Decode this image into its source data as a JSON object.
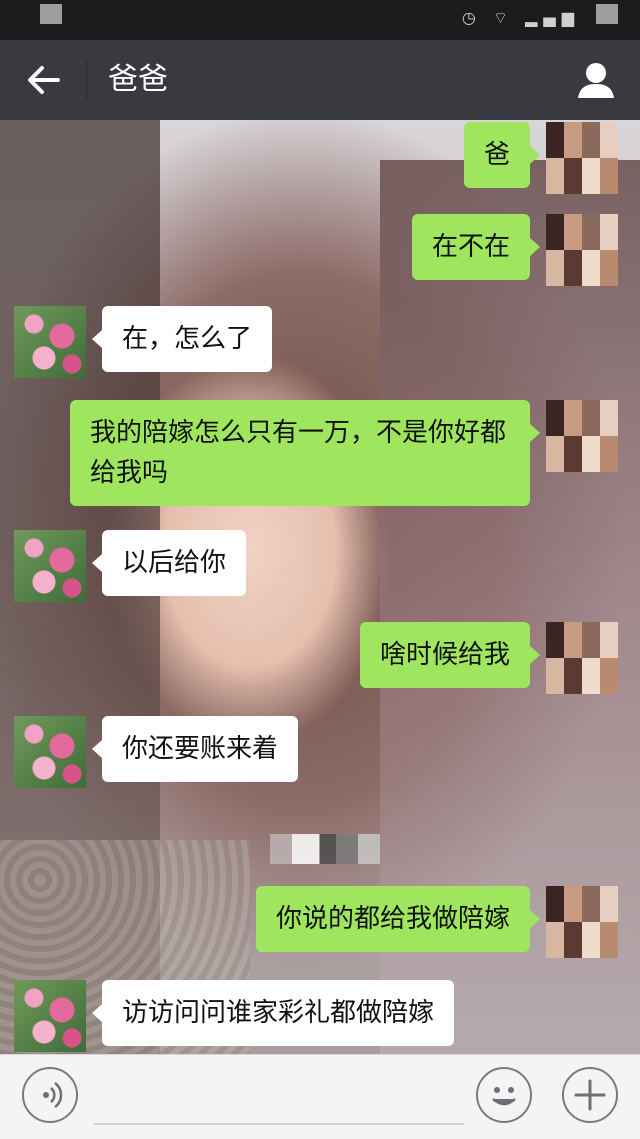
{
  "status_bar": {
    "icons": [
      "alarm-icon",
      "wifi-icon",
      "signal-icon",
      "battery-icon"
    ]
  },
  "header": {
    "title": "爸爸",
    "back_icon": "arrow-left-icon",
    "profile_icon": "person-icon"
  },
  "messages": [
    {
      "side": "right",
      "text": "爸"
    },
    {
      "side": "right",
      "text": "在不在"
    },
    {
      "side": "left",
      "text": "在，怎么了"
    },
    {
      "side": "right",
      "text": "我的陪嫁怎么只有一万，不是你好都给我吗"
    },
    {
      "side": "left",
      "text": "以后给你"
    },
    {
      "side": "right",
      "text": "啥时候给我"
    },
    {
      "side": "left",
      "text": "你还要账来着"
    },
    {
      "side": "right",
      "text": "你说的都给我做陪嫁"
    },
    {
      "side": "left",
      "text": "访访问问谁家彩礼都做陪嫁"
    }
  ],
  "input_bar": {
    "voice_icon": "voice-icon",
    "emoji_icon": "smiley-icon",
    "plus_icon": "plus-icon",
    "placeholder": ""
  },
  "colors": {
    "header_bg": "#393a3f",
    "sent_bubble": "#9fe65e",
    "received_bubble": "#ffffff"
  }
}
